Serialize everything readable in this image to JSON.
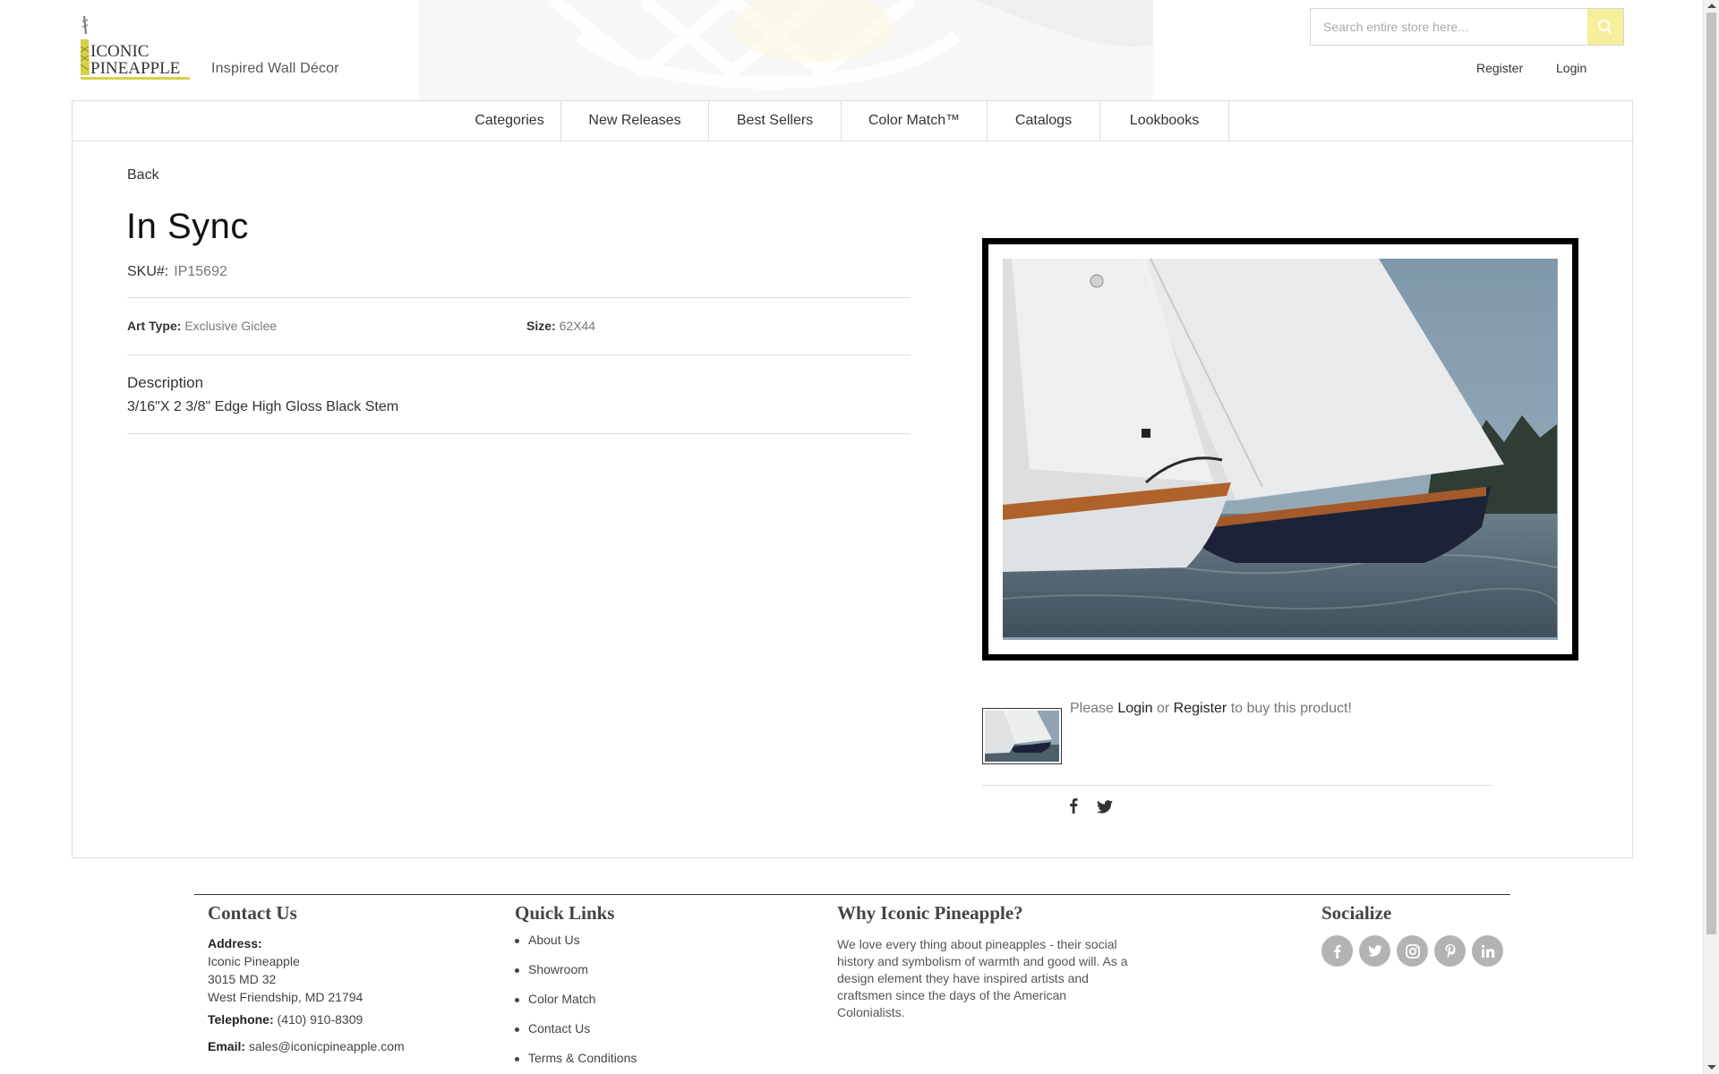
{
  "brand": {
    "logo_line1": "ICONIC",
    "logo_line2": "PINEAPPLE",
    "tagline": "Inspired Wall Décor",
    "accent_color": "#f3ef9a"
  },
  "search": {
    "placeholder": "Search entire store here..."
  },
  "account": {
    "register_label": "Register",
    "login_label": "Login"
  },
  "nav": {
    "items": [
      {
        "label": "Categories"
      },
      {
        "label": "New Releases"
      },
      {
        "label": "Best Sellers"
      },
      {
        "label": "Color Match™"
      },
      {
        "label": "Catalogs"
      },
      {
        "label": "Lookbooks"
      }
    ]
  },
  "product": {
    "back_label": "Back",
    "title": "In Sync",
    "sku_label": "SKU#:",
    "sku_value": "IP15692",
    "art_type_label": "Art Type:",
    "art_type_value": "Exclusive Giclee",
    "size_label": "Size:",
    "size_value": "62X44",
    "description_heading": "Description",
    "description_text": "3/16\"X 2 3/8\" Edge High Gloss Black Stem",
    "buy_prefix": "Please",
    "buy_login": "Login",
    "buy_or": "or",
    "buy_register": "Register",
    "buy_suffix": "to buy this product!",
    "share_icons": [
      "facebook-icon",
      "twitter-icon"
    ]
  },
  "footer": {
    "contact": {
      "heading": "Contact Us",
      "address_label": "Address:",
      "address_lines": [
        "Iconic Pineapple",
        "3015 MD 32",
        "West Friendship, MD 21794"
      ],
      "telephone_label": "Telephone:",
      "telephone": "(410) 910-8309",
      "email_label": "Email:",
      "email": "sales@iconicpineapple.com"
    },
    "quick_links": {
      "heading": "Quick Links",
      "items": [
        "About Us",
        "Showroom",
        "Color Match",
        "Contact Us",
        "Terms & Conditions"
      ]
    },
    "why": {
      "heading": "Why Iconic Pineapple?",
      "text": "We love every thing about pineapples - their social history and symbolism of warmth and good will. As a design element they have inspired artists and craftsmen since the days of the American Colonialists."
    },
    "socialize": {
      "heading": "Socialize",
      "icons": [
        "facebook-icon",
        "twitter-icon",
        "instagram-icon",
        "pinterest-icon",
        "linkedin-icon"
      ]
    }
  }
}
